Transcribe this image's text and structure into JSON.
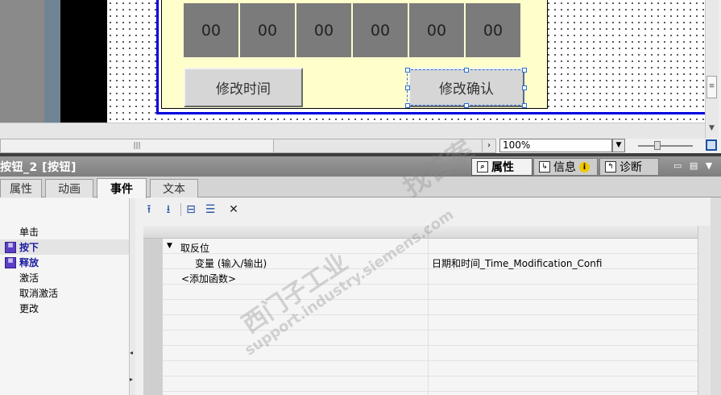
{
  "canvas": {
    "display_cells": [
      "00",
      "00",
      "00",
      "00",
      "00",
      "00"
    ],
    "button_modify_time": "修改时间",
    "button_confirm": "修改确认",
    "zoom_level": "100%"
  },
  "inspector": {
    "title": "按钮_2 [按钮]",
    "tabs": {
      "properties": "属性",
      "info": "信息",
      "diagnostics": "诊断"
    },
    "subtabs": {
      "properties": "属性",
      "animation": "动画",
      "events": "事件",
      "text": "文本"
    }
  },
  "events": {
    "items": [
      {
        "label": "单击",
        "has_icon": false,
        "bold": false
      },
      {
        "label": "按下",
        "has_icon": true,
        "bold": true
      },
      {
        "label": "释放",
        "has_icon": true,
        "bold": true
      },
      {
        "label": "激活",
        "has_icon": false,
        "bold": false
      },
      {
        "label": "取消激活",
        "has_icon": false,
        "bold": false
      },
      {
        "label": "更改",
        "has_icon": false,
        "bold": false
      }
    ]
  },
  "function_list": {
    "function_name": "取反位",
    "param_name": "变量 (输入/输出)",
    "param_value": "日期和时间_Time_Modification_Confi",
    "add_function": "<添加函数>"
  },
  "watermark": {
    "line1": "找答案",
    "line2": "西门子工业",
    "line3": "support.industry.siemens.com"
  },
  "colors": {
    "screen_bg": "#ffffcc",
    "frame_blue": "#0000e0",
    "cell_grey": "#7b7b7b",
    "event_icon": "#5b3fc4"
  }
}
